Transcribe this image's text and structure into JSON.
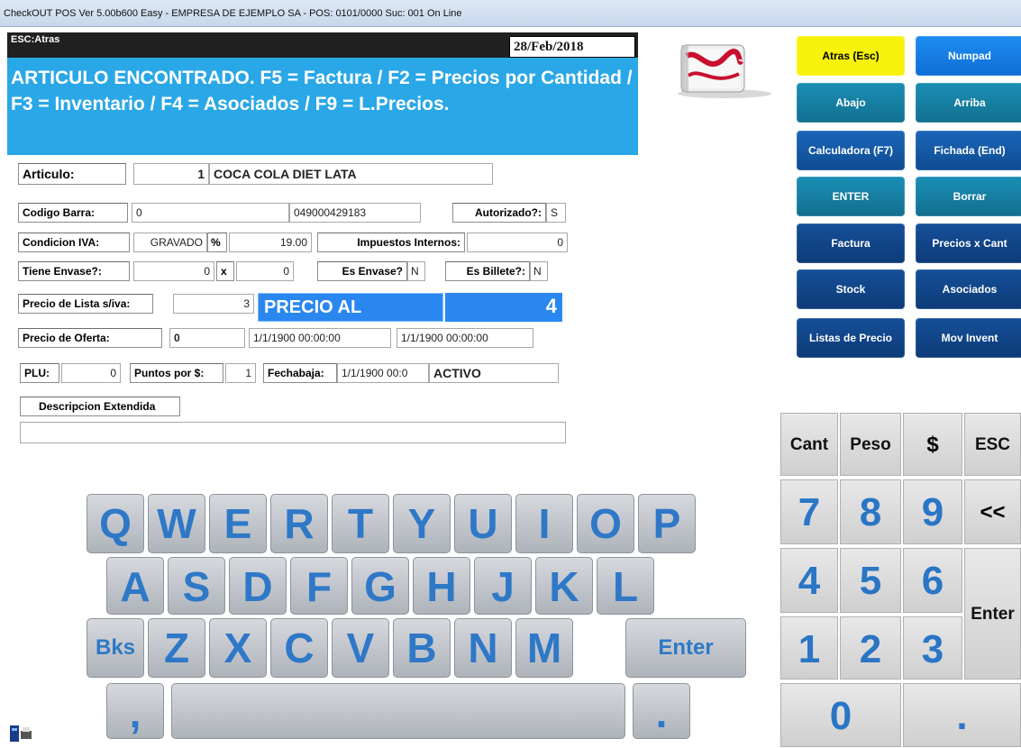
{
  "window": {
    "title": "CheckOUT POS Ver 5.00b600 Easy - EMPRESA DE EJEMPLO SA - POS: 0101/0000 Suc: 001  On Line"
  },
  "header": {
    "esc_label": "ESC:Atras",
    "date": "28/Feb/2018",
    "message": "ARTICULO ENCONTRADO. F5 = Factura / F2 = Precios por Cantidad / F3 = Inventario / F4 = Asociados / F9 = L.Precios."
  },
  "form": {
    "articulo_label": "Articulo:",
    "articulo_code": "1",
    "articulo_name": "COCA COLA DIET LATA",
    "codigo_barra_label": "Codigo Barra:",
    "codigo_barra_value": "0",
    "codigo_barra_ean": "049000429183",
    "autorizado_label": "Autorizado?:",
    "autorizado_value": "S",
    "condicion_iva_label": "Condicion IVA:",
    "condicion_iva_value": "GRAVADO",
    "percent_label": "%",
    "iva_rate": "19.00",
    "impuestos_label": "Impuestos Internos:",
    "impuestos_value": "0",
    "tiene_envase_label": "Tiene Envase?:",
    "tiene_envase_value": "0",
    "x_label": "x",
    "envase_qty": "0",
    "es_envase_label": "Es Envase?",
    "es_envase_value": "N",
    "es_billete_label": "Es Billete?:",
    "es_billete_value": "N",
    "precio_lista_label": "Precio de Lista s/iva:",
    "precio_lista_value": "3",
    "precio_publico_label": "PRECIO AL PUBLICO:",
    "precio_publico_value": "4",
    "precio_oferta_label": "Precio de Oferta:",
    "precio_oferta_value": "0",
    "oferta_desde": "1/1/1900 00:00:00",
    "oferta_hasta": "1/1/1900 00:00:00",
    "plu_label": "PLU:",
    "plu_value": "0",
    "puntos_label": "Puntos por $:",
    "puntos_value": "1",
    "fechabaja_label": "Fechabaja:",
    "fechabaja_value": "1/1/1900 00:0",
    "estado": "ACTIVO",
    "descripcion_label": "Descripcion Extendida",
    "descripcion_value": ""
  },
  "functions": [
    {
      "label": "Atras (Esc)"
    },
    {
      "label": "Numpad"
    },
    {
      "label": "Abajo"
    },
    {
      "label": "Arriba"
    },
    {
      "label": "Calculadora (F7)"
    },
    {
      "label": "Fichada (End)"
    },
    {
      "label": "ENTER"
    },
    {
      "label": "Borrar"
    },
    {
      "label": "Factura"
    },
    {
      "label": "Precios x Cant"
    },
    {
      "label": "Stock"
    },
    {
      "label": "Asociados"
    },
    {
      "label": "Listas de Precio"
    },
    {
      "label": "Mov Invent"
    }
  ],
  "keyboard": {
    "row1": [
      "Q",
      "W",
      "E",
      "R",
      "T",
      "Y",
      "U",
      "I",
      "O",
      "P"
    ],
    "row2": [
      "A",
      "S",
      "D",
      "F",
      "G",
      "H",
      "J",
      "K",
      "L"
    ],
    "row3": [
      "Bks",
      "Z",
      "X",
      "C",
      "V",
      "B",
      "N",
      "M",
      "Enter"
    ],
    "row4": [
      ",",
      "",
      "."
    ]
  },
  "numpad": {
    "top": [
      "Cant",
      "Peso",
      "$",
      "ESC"
    ],
    "r1": [
      "7",
      "8",
      "9",
      "<<"
    ],
    "r2": [
      "4",
      "5",
      "6"
    ],
    "enter": "Enter",
    "r3": [
      "1",
      "2",
      "3"
    ],
    "zero": "0",
    "dot": "."
  },
  "colors": {
    "header_bg": "#2aa7e6",
    "price_bg": "#2a87f0",
    "key_text": "#2e78c7",
    "yellow_btn": "#f7f20c"
  }
}
